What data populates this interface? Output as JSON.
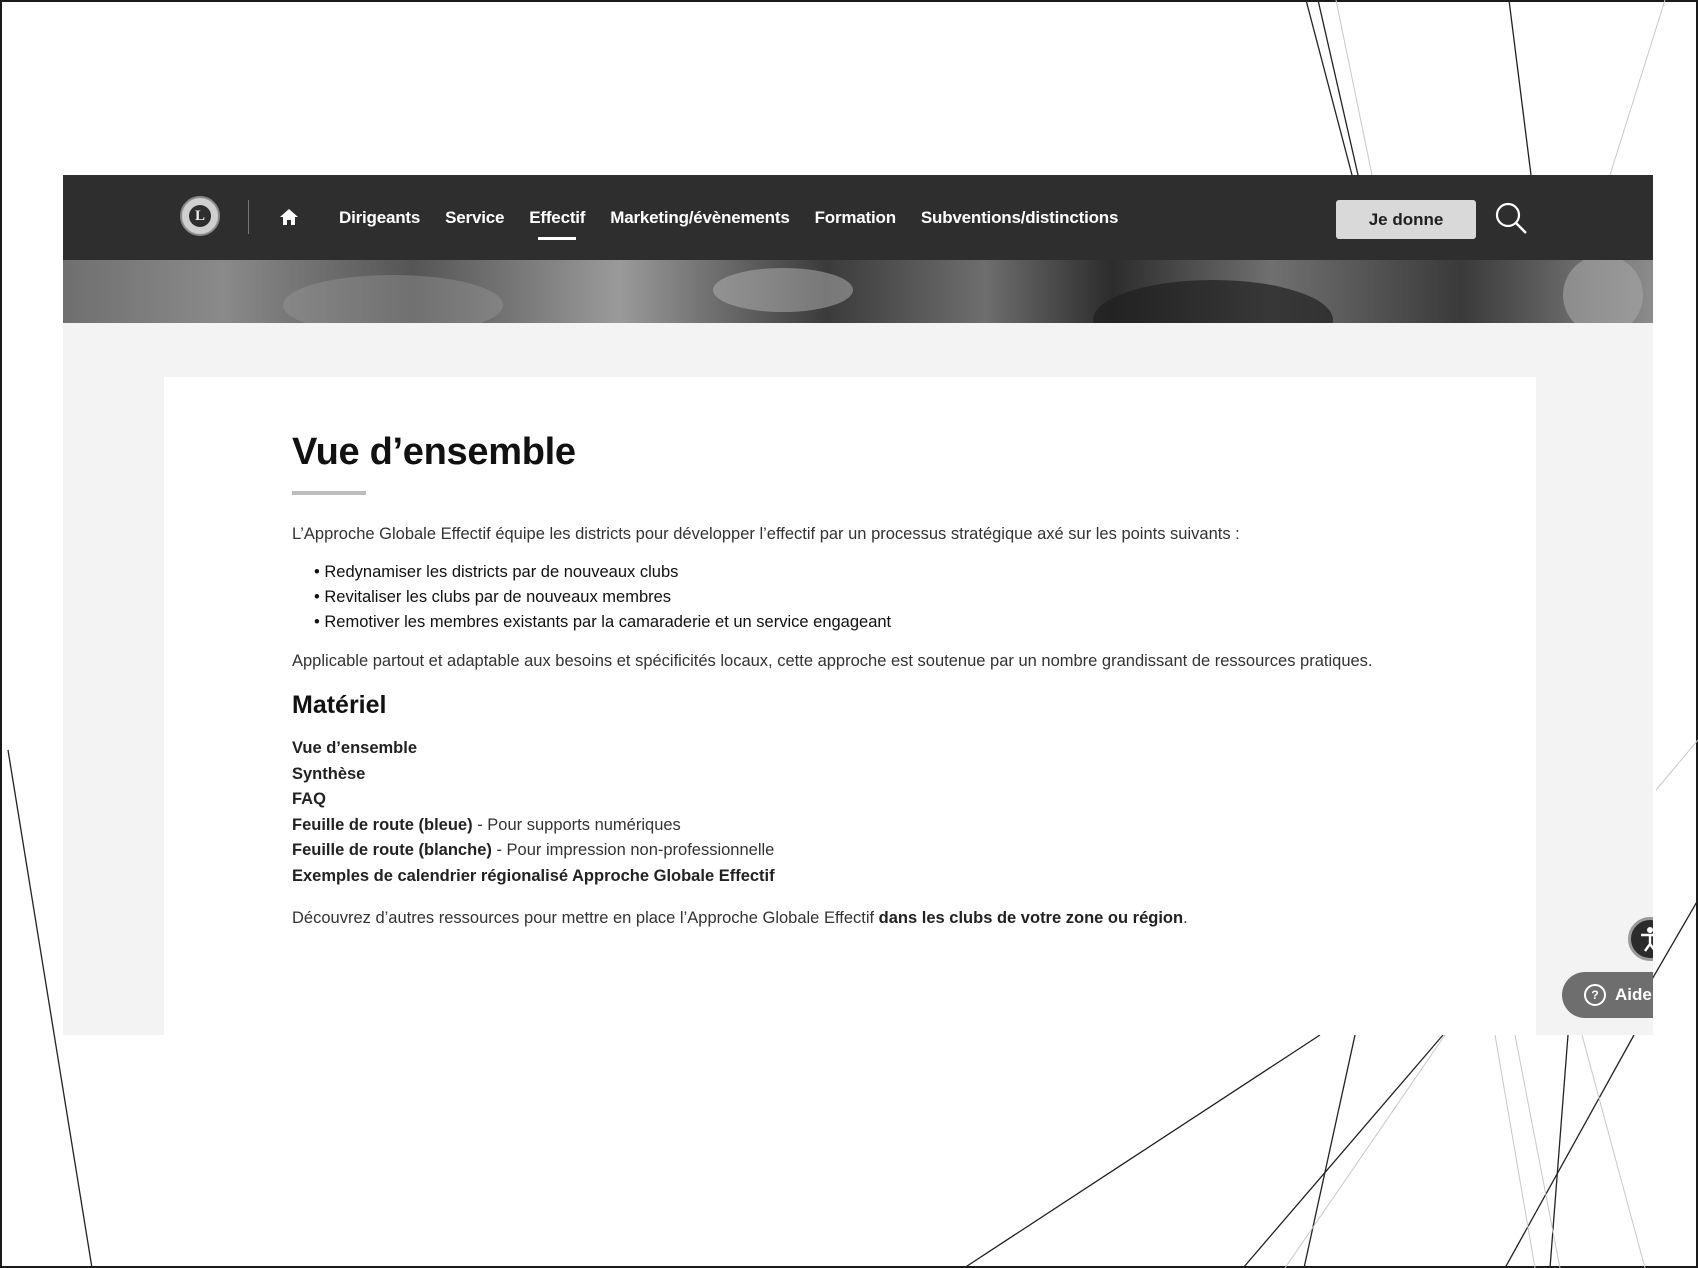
{
  "nav": {
    "logo_letter": "L",
    "links": [
      {
        "label": "Dirigeants"
      },
      {
        "label": "Service"
      },
      {
        "label": "Effectif",
        "active": true
      },
      {
        "label": "Marketing/évènements"
      },
      {
        "label": "Formation"
      },
      {
        "label": "Subventions/distinctions"
      }
    ],
    "donate_label": "Je donne",
    "home_icon": "home-icon",
    "search_icon": "search-icon"
  },
  "page": {
    "title": "Vue d’ensemble",
    "intro": "L’Approche Globale Effectif équipe les districts pour développer l’effectif par un processus stratégique axé sur les points suivants :",
    "bullets": [
      "Redynamiser les districts par de nouveaux clubs",
      "Revitaliser les clubs par de nouveaux membres",
      "Remotiver les membres existants par la camaraderie et un service engageant"
    ],
    "applicable": "Applicable partout et adaptable aux besoins et spécificités locaux, cette approche est soutenue par un nombre grandissant de ressources pratiques.",
    "materiel_heading": "Matériel",
    "materiel": [
      {
        "link": "Vue d’ensemble",
        "note": ""
      },
      {
        "link": "Synthèse",
        "note": ""
      },
      {
        "link": "FAQ",
        "note": ""
      },
      {
        "link": "Feuille de route (bleue)",
        "note": " - Pour supports numériques"
      },
      {
        "link": "Feuille de route (blanche)",
        "note": " - Pour impression non-professionnelle"
      },
      {
        "link": "Exemples de calendrier régionalisé Approche Globale Effectif",
        "note": ""
      }
    ],
    "discover_text": "Découvrez d’autres ressources pour mettre en place l’Approche Globale Effectif ",
    "discover_link": "dans les clubs de votre zone ou région",
    "discover_end": "."
  },
  "widgets": {
    "help_label": "Aide",
    "help_icon_glyph": "?",
    "accessibility_icon": "accessibility-icon"
  }
}
